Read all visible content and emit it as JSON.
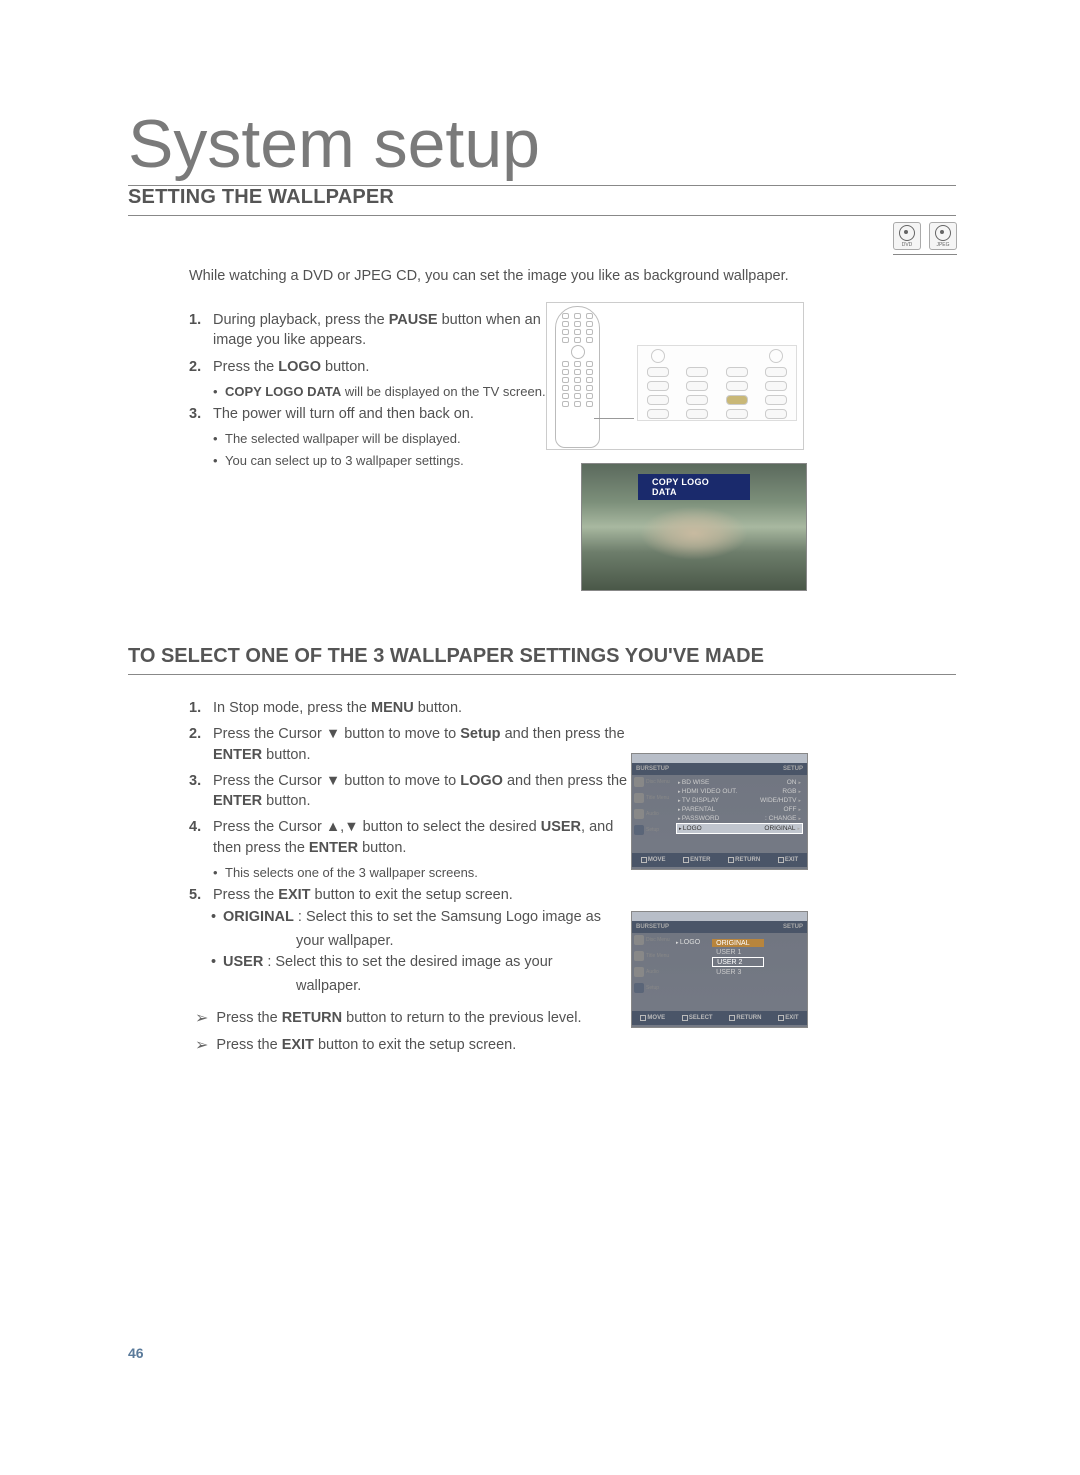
{
  "page_title": "System setup",
  "section1": {
    "title": "SETTING THE WALLPAPER",
    "disc_icons": [
      "DVD",
      "JPEG"
    ],
    "intro": "While watching a DVD or JPEG CD, you can set the image you like as background wallpaper.",
    "step1_pre": "During playback, press the ",
    "step1_key": "PAUSE",
    "step1_post": " button when an image you like appears.",
    "step2_pre": "Press the ",
    "step2_key": "LOGO",
    "step2_post": " button.",
    "step2_sub_pre": "COPY LOGO DATA",
    "step2_sub_post": " will be displayed on the TV screen.",
    "step3": "The power will turn off and then back on.",
    "step3_sub1": "The selected wallpaper will be displayed.",
    "step3_sub2": "You can select up to 3 wallpaper settings.",
    "preview_banner": "COPY LOGO DATA"
  },
  "section2": {
    "title": "TO SELECT ONE OF THE 3 WALLPAPER SETTINGS YOU'VE MADE",
    "s1_pre": "In Stop mode, press the ",
    "s1_key": "MENU",
    "s1_post": " button.",
    "s2_pre": "Press the Cursor ▼ button to move to ",
    "s2_key": "Setup",
    "s2_mid": " and then press the ",
    "s2_key2": "ENTER",
    "s2_post": " button.",
    "s3_pre": "Press the Cursor ▼ button to move to ",
    "s3_key": "LOGO",
    "s3_mid": " and then press the ",
    "s3_key2": "ENTER",
    "s3_post": " button.",
    "s4_pre": "Press the Cursor ▲,▼ button to select the desired ",
    "s4_key": "USER",
    "s4_mid": ", and then press the ",
    "s4_key2": "ENTER",
    "s4_post": " button.",
    "s4_sub": "This selects one of the 3 wallpaper screens.",
    "s5_pre": "Press the ",
    "s5_key": "EXIT",
    "s5_post": " button to exit the setup screen.",
    "opt1_key": "ORIGINAL",
    "opt1_text": " : Select this to set the Samsung Logo image as your wallpaper.",
    "opt1_wrap": "your wallpaper.",
    "opt2_key": "USER",
    "opt2_text": " : Select this to set the desired image as your wallpaper.",
    "opt2_wrap": "wallpaper.",
    "nav1_pre": "Press the ",
    "nav1_key": "RETURN",
    "nav1_post": " button to return to the previous level.",
    "nav2_pre": "Press the ",
    "nav2_key": "EXIT",
    "nav2_post": " button to exit the setup screen."
  },
  "menu1": {
    "header_left": "BURSETUP",
    "header_right": "SETUP",
    "cats": [
      "Disc Menu",
      "Title Menu",
      "Audio",
      "Setup"
    ],
    "rows": [
      {
        "label": "BD WISE",
        "val": "ON"
      },
      {
        "label": "HDMI VIDEO OUT.",
        "val": "RGB"
      },
      {
        "label": "TV DISPLAY",
        "val": "WIDE/HDTV"
      },
      {
        "label": "PARENTAL",
        "val": "OFF"
      },
      {
        "label": "PASSWORD",
        "val": "CHANGE"
      },
      {
        "label": "LOGO",
        "val": "ORIGINAL"
      }
    ],
    "footer": [
      "MOVE",
      "ENTER",
      "RETURN",
      "EXIT"
    ]
  },
  "menu2": {
    "header_left": "BURSETUP",
    "header_right": "SETUP",
    "cats": [
      "Disc Menu",
      "Title Menu",
      "Audio",
      "Setup"
    ],
    "logo_label": "LOGO",
    "options": [
      "ORIGINAL",
      "USER 1",
      "USER 2",
      "USER 3"
    ],
    "footer": [
      "MOVE",
      "SELECT",
      "RETURN",
      "EXIT"
    ]
  },
  "page_number": "46"
}
